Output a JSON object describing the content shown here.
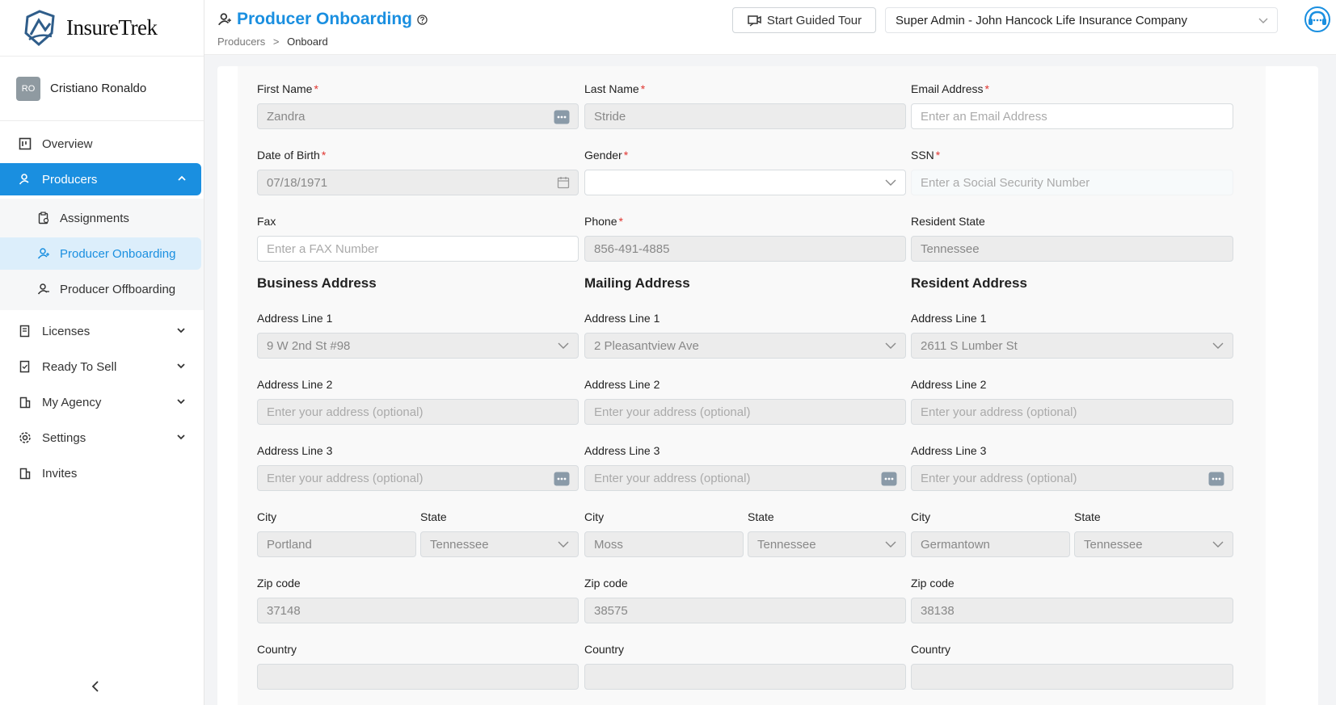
{
  "app": {
    "logo_text": "InsureTrek"
  },
  "user": {
    "initials": "RO",
    "name": "Cristiano Ronaldo"
  },
  "nav": {
    "overview": "Overview",
    "producers": "Producers",
    "assignments": "Assignments",
    "producer_onboarding": "Producer Onboarding",
    "producer_offboarding": "Producer Offboarding",
    "licenses": "Licenses",
    "ready_to_sell": "Ready To Sell",
    "my_agency": "My Agency",
    "settings": "Settings",
    "invites": "Invites"
  },
  "header": {
    "title": "Producer Onboarding",
    "breadcrumb_root": "Producers",
    "breadcrumb_sep": ">",
    "breadcrumb_current": "Onboard",
    "tour_button": "Start Guided Tour",
    "company": "Super Admin - John Hancock Life Insurance Company"
  },
  "colors": {
    "accent": "#1a8fe0",
    "required": "#e0342f"
  },
  "form": {
    "first_name": {
      "label": "First Name",
      "value": "Zandra"
    },
    "last_name": {
      "label": "Last Name",
      "value": "Stride"
    },
    "email": {
      "label": "Email Address",
      "placeholder": "Enter an Email Address"
    },
    "dob": {
      "label": "Date of Birth",
      "value": "07/18/1971"
    },
    "gender": {
      "label": "Gender",
      "value": ""
    },
    "ssn": {
      "label": "SSN",
      "placeholder": "Enter a Social Security Number"
    },
    "fax": {
      "label": "Fax",
      "placeholder": "Enter a FAX Number"
    },
    "phone": {
      "label": "Phone",
      "value": "856-491-4885"
    },
    "resident_state": {
      "label": "Resident State",
      "value": "Tennessee"
    },
    "labels": {
      "address_line_1": "Address Line 1",
      "address_line_2": "Address Line 2",
      "address_line_3": "Address Line 3",
      "city": "City",
      "state": "State",
      "zip": "Zip code",
      "country": "Country",
      "optional_placeholder": "Enter your address (optional)"
    },
    "business": {
      "heading": "Business Address",
      "line1": "9 W 2nd St #98",
      "city": "Portland",
      "state": "Tennessee",
      "zip": "37148"
    },
    "mailing": {
      "heading": "Mailing Address",
      "line1": "2 Pleasantview Ave",
      "city": "Moss",
      "state": "Tennessee",
      "zip": "38575"
    },
    "resident": {
      "heading": "Resident Address",
      "line1": "2611 S Lumber St",
      "city": "Germantown",
      "state": "Tennessee",
      "zip": "38138"
    }
  }
}
